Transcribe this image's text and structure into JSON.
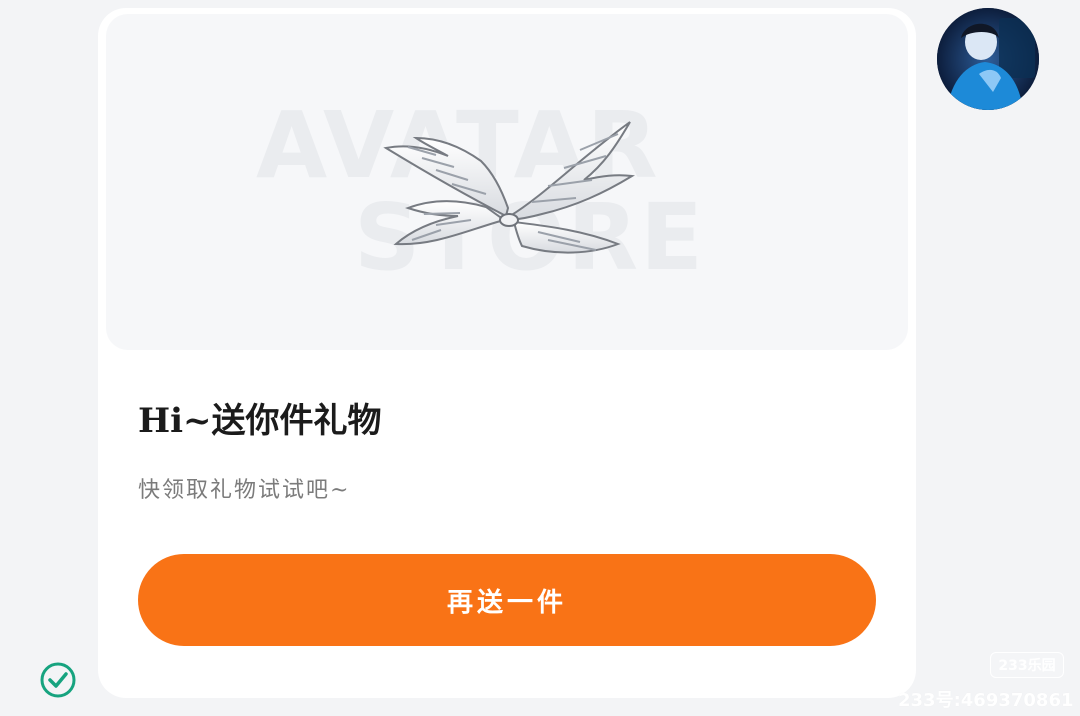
{
  "gift_card": {
    "preview_watermark_line1": "AVATAR",
    "preview_watermark_line2": "STORE",
    "title": "Hi~送你件礼物",
    "subtitle": "快领取礼物试试吧~",
    "button_label": "再送一件"
  },
  "icons": {
    "gift_item": "angel-wings-icon",
    "sent_status": "check-circle-icon"
  },
  "overlay": {
    "site_badge": "233乐园",
    "account_id": "233号:469370861"
  },
  "colors": {
    "accent": "#f97316",
    "check_green": "#16a37f",
    "page_background": "#f3f4f6"
  }
}
